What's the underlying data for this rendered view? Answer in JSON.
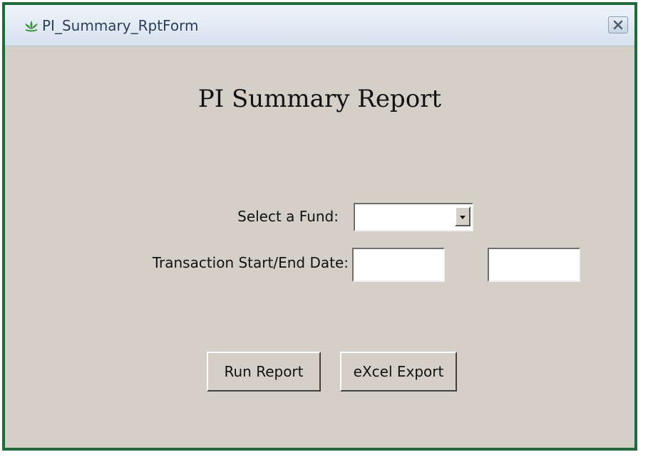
{
  "window": {
    "title": "PI_Summary_RptForm",
    "icon": "app-lotus-icon",
    "close_icon": "close-icon"
  },
  "form": {
    "heading": "PI Summary Report",
    "fund_label": "Select a Fund:",
    "fund_value": "",
    "date_label": "Transaction Start/End Date:",
    "start_date_value": "",
    "end_date_value": ""
  },
  "buttons": {
    "run_report": "Run Report",
    "excel_export": "eXcel Export"
  },
  "colors": {
    "border_green": "#1f6b3c",
    "form_background": "#d4d0c8"
  }
}
